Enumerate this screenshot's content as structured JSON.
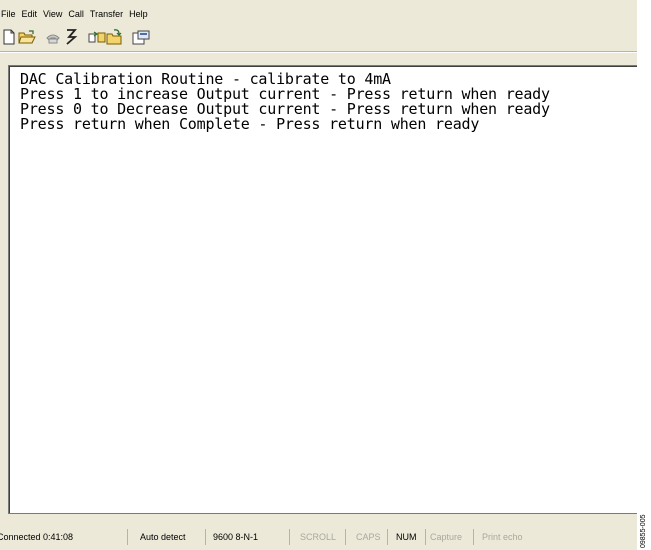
{
  "menu": [
    "File",
    "Edit",
    "View",
    "Call",
    "Transfer",
    "Help"
  ],
  "toolbar_icons": [
    "new-document-icon",
    "open-folder-icon",
    "disconnect-phone-icon",
    "send-receive-icon",
    "properties-icon"
  ],
  "terminal": {
    "lines": [
      "DAC Calibration Routine - calibrate to 4mA",
      "Press 1 to increase Output current - Press return when ready",
      "Press 0 to Decrease Output current - Press return when ready",
      "Press return when Complete - Press return when ready"
    ]
  },
  "status": {
    "connected": "Connected 0:41:08",
    "detect": "Auto detect",
    "baud": "9600 8-N-1",
    "scroll": "SCROLL",
    "caps": "CAPS",
    "num": "NUM",
    "capture": "Capture",
    "print_echo": "Print echo"
  },
  "figure_id": "09855-005"
}
